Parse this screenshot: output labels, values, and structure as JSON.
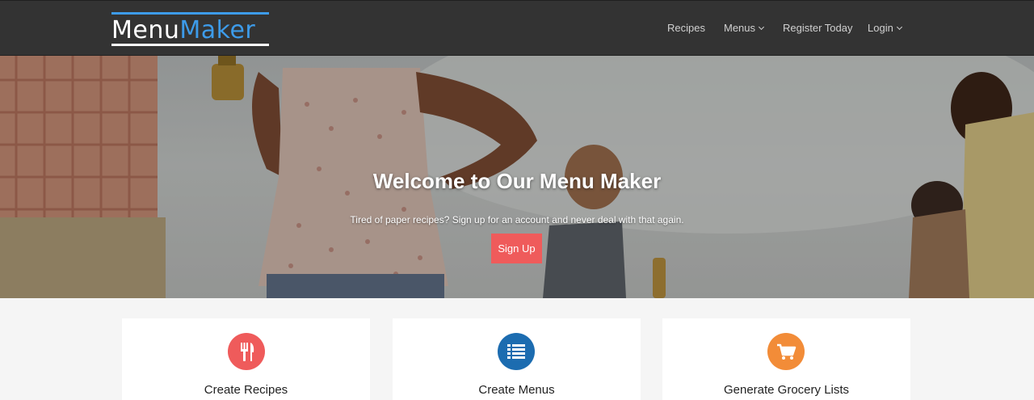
{
  "header": {
    "logo_part1": "Menu",
    "logo_part2": "Maker",
    "nav": {
      "recipes": "Recipes",
      "menus": "Menus",
      "register": "Register Today",
      "login": "Login"
    }
  },
  "hero": {
    "title": "Welcome to Our Menu Maker",
    "subtitle": "Tired of paper recipes? Sign up for an account and never deal with that again.",
    "cta_label": "Sign Up"
  },
  "features": [
    {
      "title": "Create Recipes",
      "icon": "fork-knife-icon",
      "color": "#ef5b5b"
    },
    {
      "title": "Create Menus",
      "icon": "list-icon",
      "color": "#1c6cb0"
    },
    {
      "title": "Generate Grocery Lists",
      "icon": "shopping-cart-icon",
      "color": "#f28c38"
    }
  ],
  "colors": {
    "navbar": "#333333",
    "accent_blue": "#3d9be9",
    "cta_red": "#ef5b5b"
  }
}
